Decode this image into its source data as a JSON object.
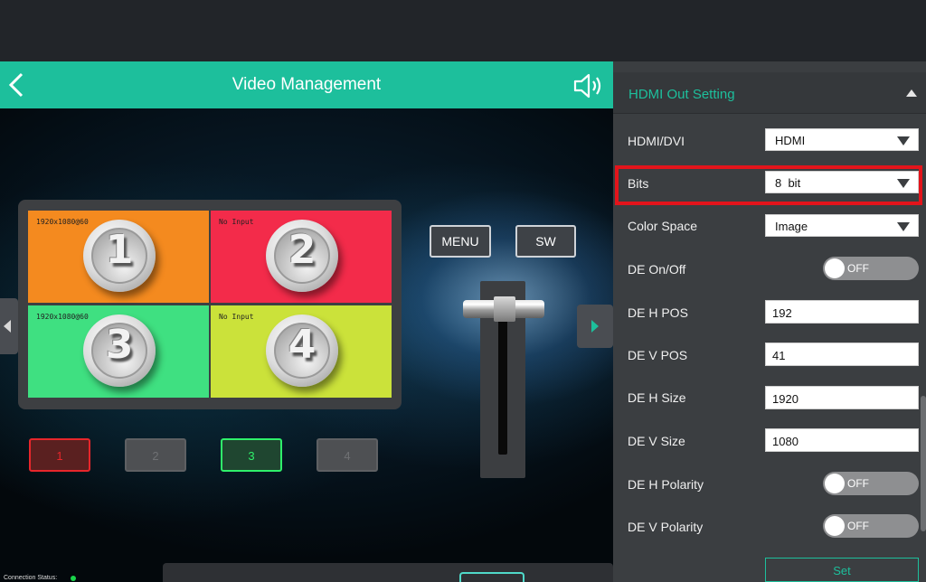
{
  "header": {
    "title": "Video Management"
  },
  "controls": {
    "menu_label": "MENU",
    "sw_label": "SW"
  },
  "monitor": {
    "tiles": [
      {
        "res": "1920x1080@60",
        "number": "1",
        "color": "#f48a1f"
      },
      {
        "res": "No Input",
        "number": "2",
        "color": "#f32b4a"
      },
      {
        "res": "1920x1080@60",
        "number": "3",
        "color": "#3fe081"
      },
      {
        "res": "No Input",
        "number": "4",
        "color": "#cbe23a"
      }
    ]
  },
  "channels": [
    {
      "label": "1",
      "state": "active-red"
    },
    {
      "label": "2",
      "state": "inactive"
    },
    {
      "label": "3",
      "state": "active-green"
    },
    {
      "label": "4",
      "state": "inactive"
    }
  ],
  "status": {
    "label": "Connection Status:",
    "color": "#19d44a"
  },
  "panel": {
    "section_title": "HDMI Out Setting",
    "rows": {
      "hdmi_dvi": {
        "label": "HDMI/DVI",
        "value": "HDMI"
      },
      "bits": {
        "label": "Bits",
        "value": "8  bit"
      },
      "color_space": {
        "label": "Color Space",
        "value": "Image"
      },
      "de_on_off": {
        "label": "DE On/Off",
        "value": "OFF"
      },
      "de_h_pos": {
        "label": "DE H POS",
        "value": "192"
      },
      "de_v_pos": {
        "label": "DE V POS",
        "value": "41"
      },
      "de_h_size": {
        "label": "DE H Size",
        "value": "1920"
      },
      "de_v_size": {
        "label": "DE V Size",
        "value": "1080"
      },
      "de_h_polarity": {
        "label": "DE H Polarity",
        "value": "OFF"
      },
      "de_v_polarity": {
        "label": "DE V Polarity",
        "value": "OFF"
      }
    },
    "set_label": "Set"
  },
  "colors": {
    "accent": "#1dbf9c",
    "highlight": "#e3141b"
  }
}
